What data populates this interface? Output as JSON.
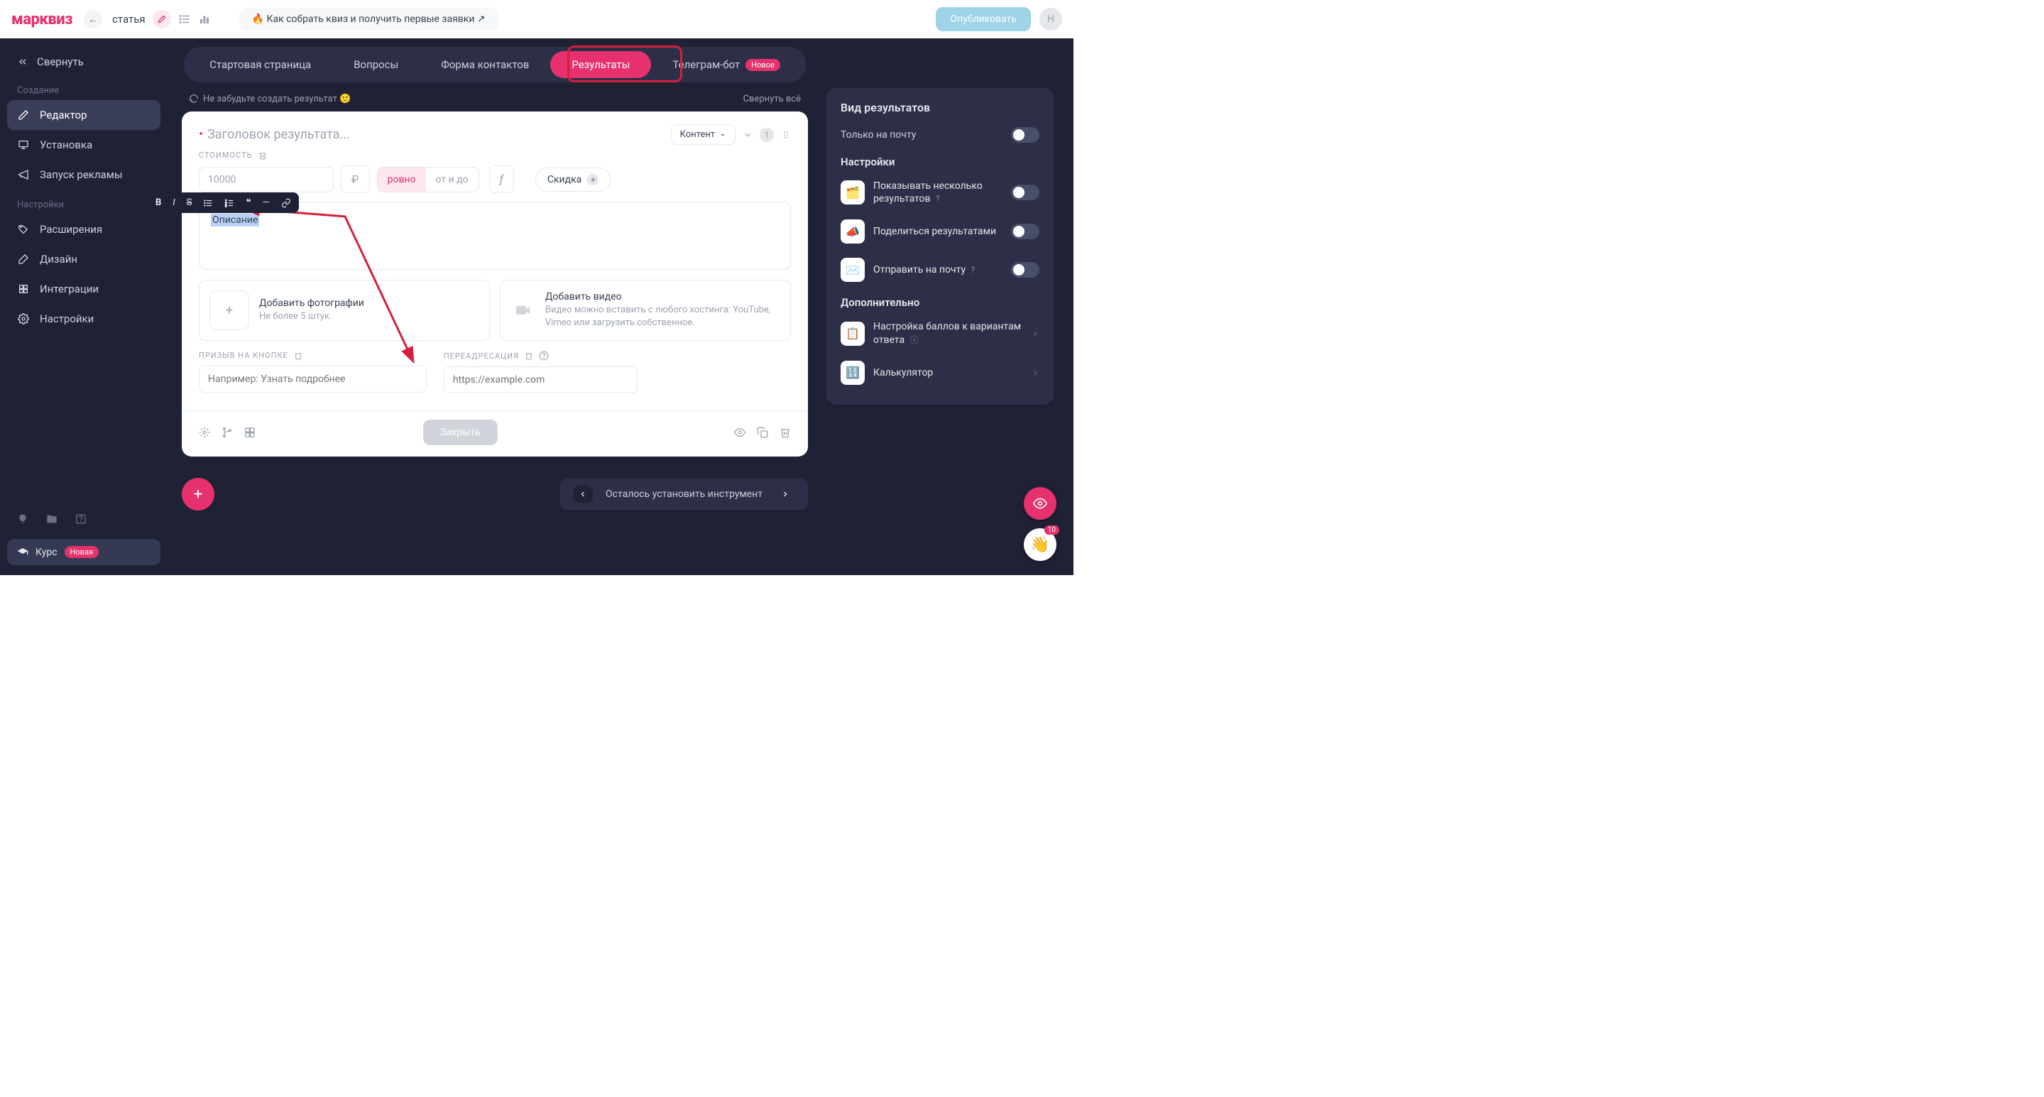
{
  "topbar": {
    "logo": "марквиз",
    "doc_title": "статья",
    "promo": "🔥 Как собрать квиз и получить первые заявки ↗",
    "publish": "Опубликовать",
    "avatar_initial": "Н"
  },
  "sidebar": {
    "collapse": "Свернуть",
    "sections": {
      "creation": "Создание",
      "settings": "Настройки"
    },
    "items": {
      "editor": "Редактор",
      "install": "Установка",
      "ads": "Запуск рекламы",
      "extensions": "Расширения",
      "design": "Дизайн",
      "integrations": "Интеграции",
      "settings": "Настройки"
    },
    "course": "Курс",
    "course_badge": "Новая"
  },
  "tabs": {
    "start": "Стартовая страница",
    "questions": "Вопросы",
    "contacts": "Форма контактов",
    "results": "Результаты",
    "bot": "Телеграм-бот",
    "bot_badge": "Новое"
  },
  "hint": {
    "left": "Не забудьте создать результат 🙂",
    "right": "Свернуть всё"
  },
  "card": {
    "title_placeholder": "Заголовок результата...",
    "content_dd": "Контент",
    "count": "1",
    "cost_label": "СТОИМОСТЬ",
    "cost_placeholder": "10000",
    "currency": "₽",
    "toggle_exact": "ровно",
    "toggle_range": "от и до",
    "fx": "ƒ",
    "discount": "Скидка",
    "desc_selected": "Описание",
    "photos_title": "Добавить фотографии",
    "photos_sub": "Не более 5 штук.",
    "video_title": "Добавить видео",
    "video_sub": "Видео можно вставить с любого хостинга: YouTube, Vimeo или загрузить собственное.",
    "cta_label": "ПРИЗЫВ НА КНОПКЕ",
    "cta_placeholder": "Например: Узнать подробнее",
    "redirect_label": "ПЕРЕАДРЕСАЦИЯ",
    "redirect_placeholder": "https://example.com",
    "close": "Закрыть"
  },
  "bottom": {
    "remaining": "Осталось установить инструмент"
  },
  "right_panel": {
    "view_heading": "Вид результатов",
    "email_only": "Только на почту",
    "settings_heading": "Настройки",
    "show_multiple": "Показывать несколько результатов",
    "share": "Поделиться результатами",
    "send_email": "Отправить на почту",
    "extra_heading": "Дополнительно",
    "scores": "Настройка баллов к вариантам ответа",
    "calculator": "Калькулятор"
  },
  "float": {
    "notif_count": "10"
  }
}
